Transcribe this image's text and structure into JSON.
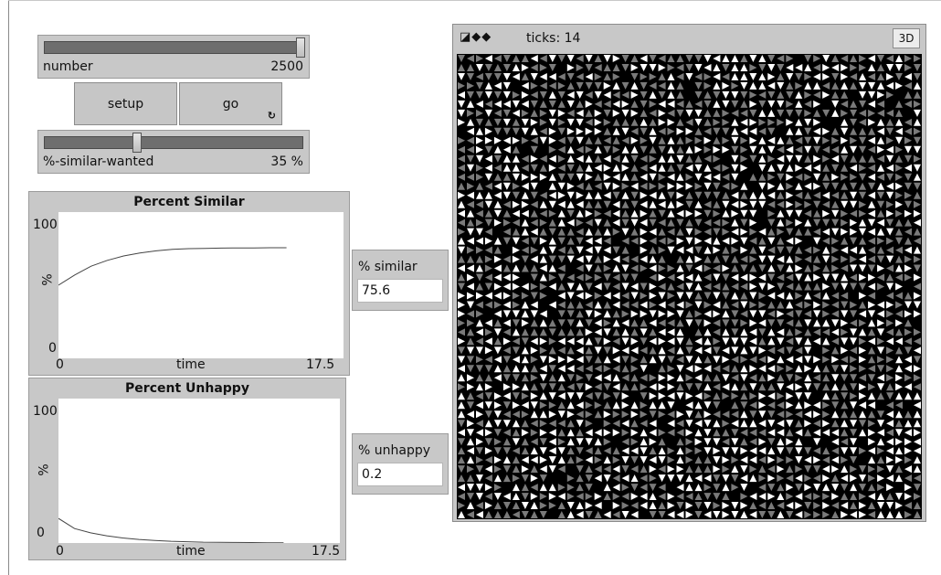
{
  "sliders": {
    "number": {
      "label": "number",
      "value": "2500",
      "level": 1.0
    },
    "similar": {
      "label": "%-similar-wanted",
      "value": "35 %",
      "level": 0.35
    }
  },
  "buttons": {
    "setup": "setup",
    "go": "go",
    "go_forever_icon": "loop-arrows-icon"
  },
  "plots": {
    "similar": {
      "title": "Percent Similar",
      "ymax": "100",
      "ymin": "0",
      "ylabel": "%",
      "xmin": "0",
      "xmax": "17.5",
      "xlabel": "time",
      "chart_data": {
        "type": "line",
        "xlim": [
          0,
          17.5
        ],
        "ylim": [
          0,
          100
        ],
        "x": [
          0,
          1,
          2,
          3,
          4,
          5,
          6,
          7,
          8,
          9,
          10,
          11,
          12,
          13,
          14
        ],
        "values": [
          50,
          57,
          63,
          67,
          70,
          72,
          73.5,
          74.5,
          75,
          75.2,
          75.4,
          75.5,
          75.5,
          75.6,
          75.6
        ]
      }
    },
    "unhappy": {
      "title": "Percent Unhappy",
      "ymax": "100",
      "ymin": "0",
      "ylabel": "%",
      "xmin": "0",
      "xmax": "17.5",
      "xlabel": "time",
      "chart_data": {
        "type": "line",
        "xlim": [
          0,
          17.5
        ],
        "ylim": [
          0,
          100
        ],
        "x": [
          0,
          1,
          2,
          3,
          4,
          5,
          6,
          7,
          8,
          9,
          10,
          11,
          12,
          13,
          14
        ],
        "values": [
          17,
          10,
          7,
          5,
          3.5,
          2.5,
          1.8,
          1.2,
          0.9,
          0.6,
          0.5,
          0.4,
          0.3,
          0.2,
          0.2
        ]
      }
    }
  },
  "monitors": {
    "similar": {
      "label": "% similar",
      "value": "75.6"
    },
    "unhappy": {
      "label": "% unhappy",
      "value": "0.2"
    }
  },
  "view": {
    "controls": "◪◆◆",
    "ticks": "ticks: 14",
    "button_3d": "3D",
    "colors": {
      "background": "#000000",
      "group_a": "#ffffff",
      "group_b": "#7a7a7a"
    }
  }
}
